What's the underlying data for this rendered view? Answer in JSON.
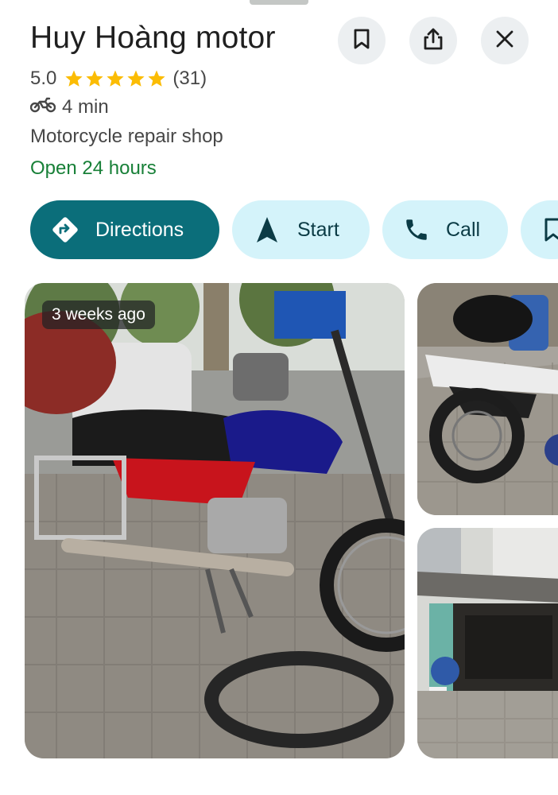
{
  "place": {
    "name": "Huy Hoàng motor",
    "rating": "5.0",
    "stars": 5,
    "review_count": "(31)",
    "travel_mode_icon": "motorcycle-icon",
    "travel_time": "4 min",
    "category": "Motorcycle repair shop",
    "hours_status": "Open 24 hours"
  },
  "header_actions": [
    {
      "name": "save",
      "icon": "bookmark-icon"
    },
    {
      "name": "share",
      "icon": "share-icon"
    },
    {
      "name": "close",
      "icon": "close-icon"
    }
  ],
  "actions": {
    "directions_label": "Directions",
    "start_label": "Start",
    "call_label": "Call"
  },
  "photos": {
    "main_badge": "3 weeks ago"
  },
  "colors": {
    "accent": "#0b6e7a",
    "chip_tonal": "#d4f3fa",
    "open_green": "#188038",
    "star": "#fbbc04"
  }
}
